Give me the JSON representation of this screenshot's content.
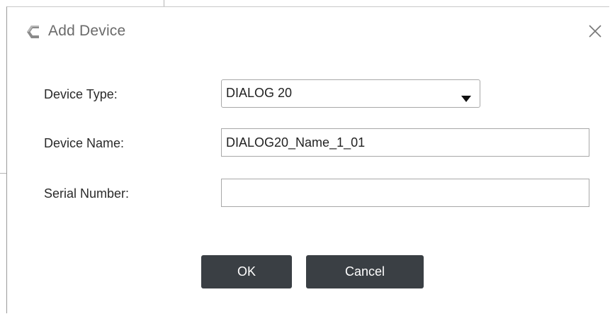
{
  "dialog": {
    "title": "Add Device",
    "device_type": {
      "label": "Device Type:",
      "selected": "DIALOG 20"
    },
    "device_name": {
      "label": "Device Name:",
      "value": "DIALOG20_Name_1_01"
    },
    "serial_number": {
      "label": "Serial Number:",
      "value": ""
    },
    "ok_label": "OK",
    "cancel_label": "Cancel"
  },
  "icons": {
    "app": "app-logo-icon",
    "close": "close-icon",
    "dropdown": "caret-down-icon"
  },
  "colors": {
    "button_bg": "#3a3f44",
    "button_text": "#ffffff",
    "title_text": "#6a6a6a",
    "field_border": "#a8a8a8"
  }
}
